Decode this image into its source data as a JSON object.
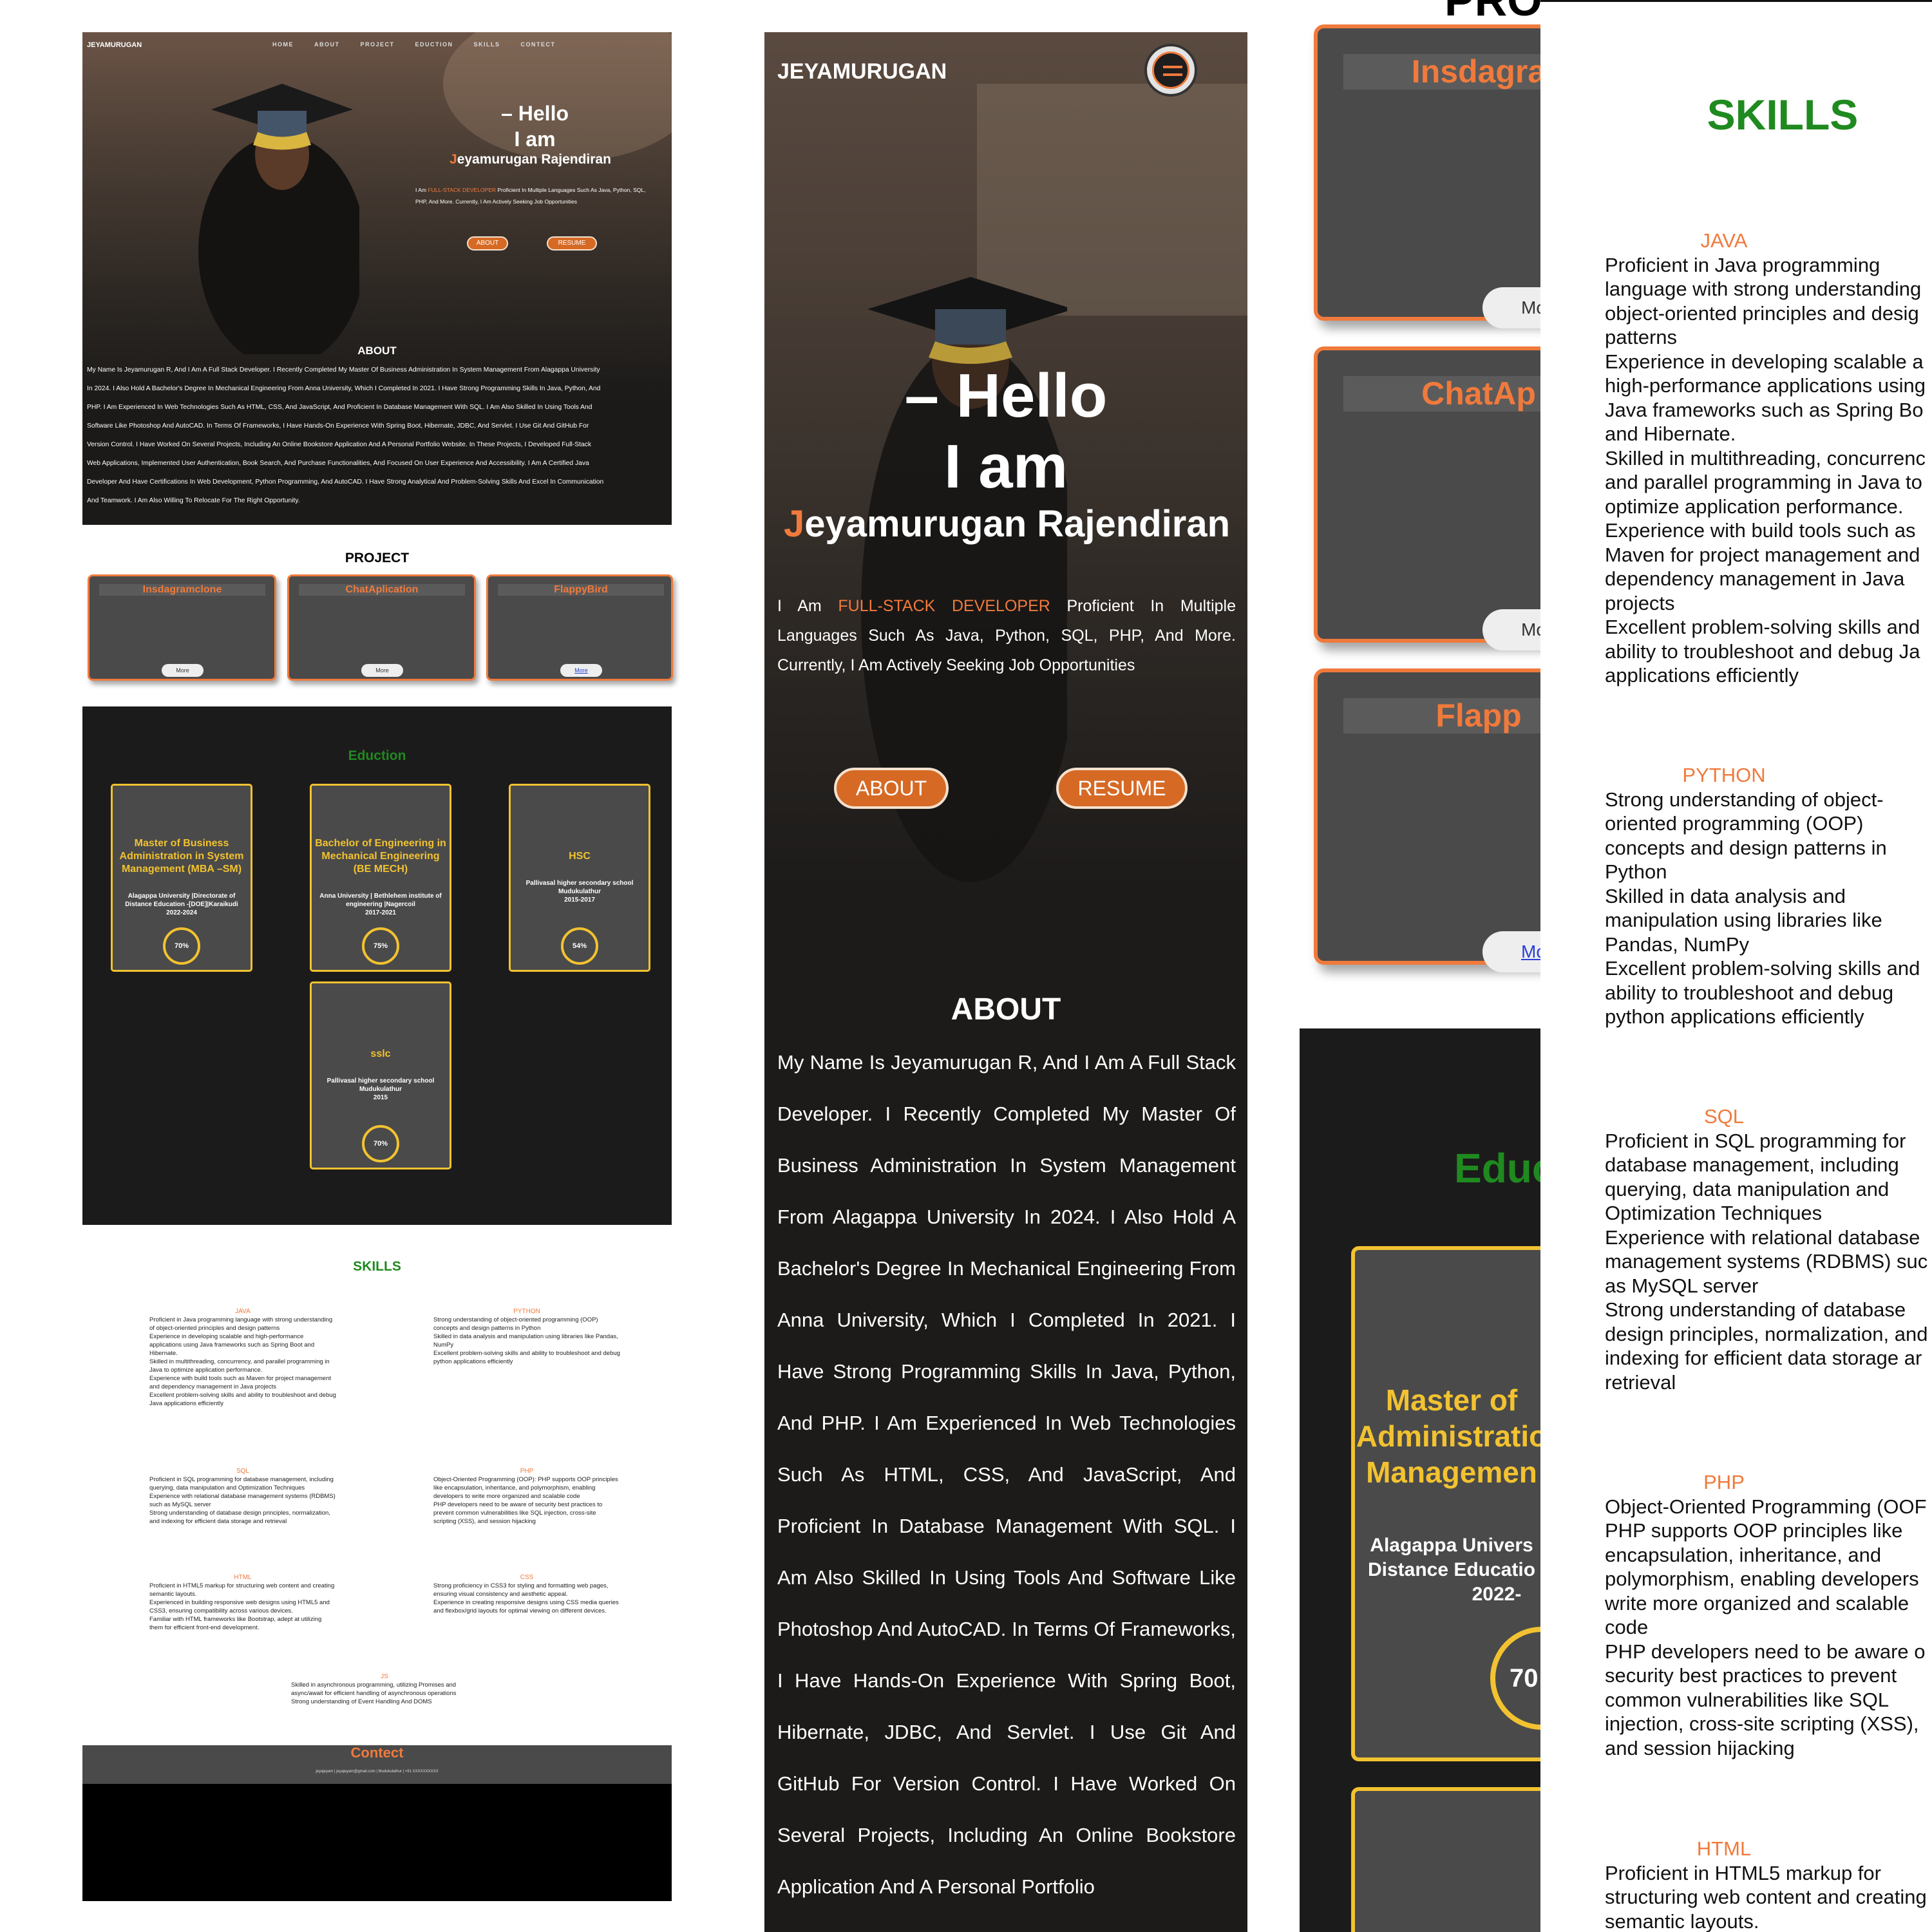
{
  "nav": {
    "logo": "JEYAMURUGAN",
    "links": [
      "HOME",
      "ABOUT",
      "PROJECT",
      "EDUCTION",
      "SKILLS",
      "CONTECT"
    ]
  },
  "hero": {
    "dash": "–",
    "hello": "Hello",
    "iam": "I am",
    "name_initial": "J",
    "name_rest": "eyamurugan Rajendiran",
    "intro_prefix": "I Am ",
    "intro_highlight": "FULL-STACK DEVELOPER",
    "intro_suffix": " Proficient In Multiple Languages Such As Java, Python, SQL, PHP, And More. Currently, I Am Actively Seeking Job Opportunities",
    "about_button": "ABOUT",
    "resume_button": "RESUME"
  },
  "about": {
    "title": "ABOUT",
    "text": "My Name Is Jeyamurugan R, And I Am A Full Stack Developer. I Recently Completed My Master Of Business Administration In System Management From Alagappa University In 2024. I Also Hold A Bachelor's Degree In Mechanical Engineering From Anna University, Which I Completed In 2021. I Have Strong Programming Skills In Java, Python, And PHP. I Am Experienced In Web Technologies Such As HTML, CSS, And JavaScript, And Proficient In Database Management With SQL. I Am Also Skilled In Using Tools And Software Like Photoshop And AutoCAD. In Terms Of Frameworks, I Have Hands-On Experience With Spring Boot, Hibernate, JDBC, And Servlet. I Use Git And GitHub For Version Control. I Have Worked On Several Projects, Including An Online Bookstore Application And A Personal Portfolio Website. In These Projects, I Developed Full-Stack Web Applications, Implemented User Authentication, Book Search, And Purchase Functionalities, And Focused On User Experience And Accessibility. I Am A Certified Java Developer And Have Certifications In Web Development, Python Programming, And AutoCAD. I Have Strong Analytical And Problem-Solving Skills And Excel In Communication And Teamwork. I Am Also Willing To Relocate For The Right Opportunity.",
    "lines": [
      "My Name Is Jeyamurugan R, And I Am A Full Stack Developer. I Recently Completed My Master Of Business Administration In System Management From Alagappa University",
      "In 2024. I Also Hold A Bachelor's Degree In Mechanical Engineering From Anna University, Which I Completed In 2021. I Have Strong Programming Skills In Java, Python, And",
      "PHP. I Am Experienced In Web Technologies Such As HTML, CSS, And JavaScript, And Proficient In Database Management With SQL. I Am Also Skilled In Using Tools And",
      "Software Like Photoshop And AutoCAD. In Terms Of Frameworks, I Have Hands-On Experience With Spring Boot, Hibernate, JDBC, And Servlet. I Use Git And GitHub For",
      "Version Control. I Have Worked On Several Projects, Including An Online Bookstore Application And A Personal Portfolio Website. In These Projects, I Developed Full-Stack",
      "Web Applications, Implemented User Authentication, Book Search, And Purchase Functionalities, And Focused On User Experience And Accessibility. I Am A Certified Java",
      "Developer And Have Certifications In Web Development, Python Programming, And AutoCAD. I Have Strong Analytical And Problem-Solving Skills And Excel In Communication",
      "And Teamwork. I Am Also Willing To Relocate For The Right Opportunity."
    ],
    "mobile_text": "My Name Is Jeyamurugan R, And I Am A Full Stack Developer. I Recently Completed My Master Of Business Administration In System Management From Alagappa University In 2024. I Also Hold A Bachelor's Degree In Mechanical Engineering From Anna University, Which I Completed In 2021. I Have Strong Programming Skills In Java, Python, And PHP. I Am Experienced In Web Technologies Such As HTML, CSS, And JavaScript, And Proficient In Database Management With SQL. I Am Also Skilled In Using Tools And Software Like Photoshop And AutoCAD. In Terms Of Frameworks, I Have Hands-On Experience With Spring Boot, Hibernate, JDBC, And Servlet. I Use Git And GitHub For Version Control. I Have Worked On Several Projects, Including An Online Bookstore Application And A Personal Portfolio"
  },
  "projects": {
    "title": "PROJECT",
    "cropped_title": "PRO",
    "items": [
      {
        "name": "Insdagramclone",
        "cropped": "Insdagra",
        "more": "More",
        "more_cropped": "Mo"
      },
      {
        "name": "ChatAplication",
        "cropped": "ChatAp",
        "more": "More",
        "more_cropped": "Mo"
      },
      {
        "name": "FlappyBird",
        "cropped": "Flapp",
        "more": "More",
        "more_cropped": "Mo"
      }
    ]
  },
  "education": {
    "title": "Eduction",
    "cropped_title": "Educ",
    "items": [
      {
        "degree": "Master of Business Administration in System Management (MBA –SM)",
        "institution": "Alagappa University |Directorate of Distance Education -[DOE]|Karaikudi",
        "years": "2022-2024",
        "score": "70%",
        "progress": 0.7
      },
      {
        "degree": "Bachelor of Engineering in Mechanical Engineering (BE MECH)",
        "institution": "Anna University | Bethlehem institute of engineering |Nagercoil",
        "years": "2017-2021",
        "score": "75%",
        "progress": 0.75
      },
      {
        "degree": "HSC",
        "institution": "Pallivasal higher secondary school Mudukulathur",
        "years": "2015-2017",
        "score": "54%",
        "progress": 0.54
      },
      {
        "degree": "sslc",
        "institution": "Pallivasal higher secondary school Mudukulathur",
        "years": "2015",
        "score": "70%",
        "progress": 0.7
      }
    ],
    "cropped_card": {
      "degree_lines": [
        "Master of",
        "Administratio",
        "Managemen"
      ],
      "inst_lines": [
        "Alagappa Univers",
        "Distance Educatio",
        "2022-"
      ],
      "score": "70"
    }
  },
  "skills": {
    "title": "SKILLS",
    "items": [
      {
        "name": "JAVA",
        "points": [
          "Proficient in Java programming language with strong understanding of object-oriented principles and design patterns",
          "Experience in developing scalable and high-performance applications using Java frameworks such as Spring Boot and Hibernate.",
          "Skilled in multithreading, concurrency, and parallel programming in Java to optimize application performance.",
          "Experience with build tools such as Maven for project management and dependency management in Java projects",
          "Excellent problem-solving skills and ability to troubleshoot and debug Java applications efficiently"
        ]
      },
      {
        "name": "PYTHON",
        "points": [
          "Strong understanding of object-oriented programming (OOP) concepts and design patterns in Python",
          "Skilled in data analysis and manipulation using libraries like Pandas, NumPy",
          "Excellent problem-solving skills and ability to troubleshoot and debug python applications efficiently"
        ]
      },
      {
        "name": "SQL",
        "points": [
          "Proficient in SQL programming for database management, including querying, data manipulation and Optimization Techniques",
          "Experience with relational database management systems (RDBMS) such as MySQL server",
          "Strong understanding of database design principles, normalization, and indexing for efficient data storage and retrieval"
        ]
      },
      {
        "name": "PHP",
        "points": [
          "Object-Oriented Programming (OOP): PHP supports OOP principles like encapsulation, inheritance, and polymorphism, enabling developers to write more organized and scalable code",
          "PHP developers need to be aware of security best practices to prevent common vulnerabilities like SQL injection, cross-site scripting (XSS), and session hijacking"
        ]
      },
      {
        "name": "HTML",
        "points": [
          "Proficient in HTML5 markup for structuring web content and creating semantic layouts.",
          "Experienced in building responsive web designs using HTML5 and CSS3, ensuring compatibility across various devices.",
          "Familiar with HTML frameworks like Bootstrap, adept at utilizing them for efficient front-end development."
        ]
      },
      {
        "name": "CSS",
        "points": [
          "Strong proficiency in CSS3 for styling and formatting web pages, ensuring visual consistency and aesthetic appeal.",
          "Experience in creating responsive designs using CSS media queries and flexbox/grid layouts for optimal viewing on different devices."
        ]
      },
      {
        "name": "JS",
        "points": [
          "Skilled in asynchronous programming, utilizing Promises and async/await for efficient handling of asynchronous operations",
          "Strong understanding of Event Handling And DOMS"
        ]
      }
    ],
    "mobile_lines": {
      "JAVA": [
        "Proficient in Java programming",
        "language with strong understanding",
        "object-oriented principles and desig",
        "patterns",
        "Experience in developing scalable a",
        "high-performance applications using",
        "Java frameworks such as Spring Bo",
        "and Hibernate.",
        "Skilled in multithreading, concurrenc",
        "and parallel programming in Java to",
        "optimize application performance.",
        "Experience with build tools such as",
        "Maven for project management and",
        "dependency management in Java",
        "projects",
        "Excellent problem-solving skills and",
        "ability to troubleshoot and debug Ja",
        "applications efficiently"
      ],
      "PYTHON": [
        "Strong understanding of object-",
        "oriented programming (OOP)",
        "concepts and design patterns in",
        "Python",
        "Skilled in data analysis and",
        "manipulation using libraries like",
        "Pandas, NumPy",
        "Excellent problem-solving skills and",
        "ability to troubleshoot and debug",
        "python applications efficiently"
      ],
      "SQL": [
        "Proficient in SQL programming for",
        "database management, including",
        "querying, data manipulation and",
        "Optimization Techniques",
        "Experience with relational database",
        "management systems (RDBMS) suc",
        "as MySQL server",
        "Strong understanding of database",
        "design principles, normalization, and",
        "indexing for efficient data storage ar",
        "retrieval"
      ],
      "PHP": [
        "Object-Oriented Programming (OOF",
        "PHP supports OOP principles like",
        "encapsulation, inheritance, and",
        "polymorphism, enabling developers",
        "write more organized and scalable",
        "code",
        "PHP developers need to be aware o",
        "security best practices to prevent",
        "common vulnerabilities like SQL",
        "injection, cross-site scripting (XSS),",
        "and session hijacking"
      ],
      "HTML": [
        "Proficient in HTML5 markup for",
        "structuring web content and creating",
        "semantic layouts."
      ]
    }
  },
  "contact": {
    "title": "Contect",
    "info": "jeyajeyam | jeyajeyam@gmail.com | Mudukulathur | +91 XXXXXXXXXX"
  },
  "colors": {
    "accent": "#f07a3c",
    "edu_border": "#f2c230",
    "heading_green": "#1f8a1f",
    "dark_bg": "#1c1b1b",
    "card_bg": "#4a4a4a"
  }
}
